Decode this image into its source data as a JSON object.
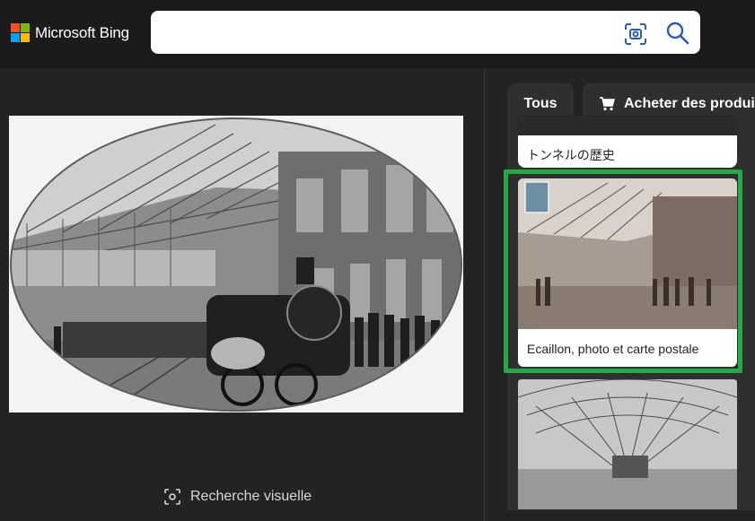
{
  "header": {
    "brand": "Microsoft Bing",
    "search_value": "",
    "colors": {
      "ms_red": "#f25022",
      "ms_green": "#7fba00",
      "ms_blue": "#00a4ef",
      "ms_yellow": "#ffb900"
    }
  },
  "main": {
    "visual_search_label": "Recherche visuelle"
  },
  "tabs": [
    {
      "label": "Tous"
    },
    {
      "label": "Acheter des produits"
    }
  ],
  "results": [
    {
      "label": "トンネルの歴史"
    },
    {
      "label": "Ecaillon, photo et carte postale"
    },
    {
      "label": ""
    }
  ],
  "highlight_color": "#27a745"
}
